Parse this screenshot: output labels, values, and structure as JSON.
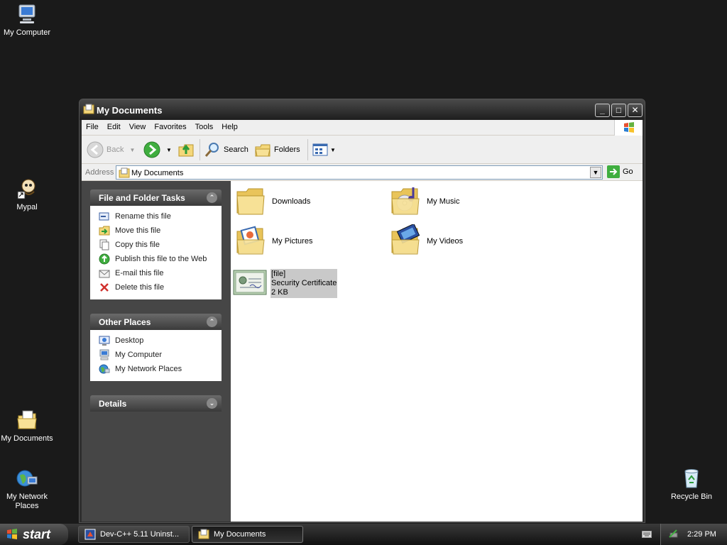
{
  "desktop": {
    "icons": [
      {
        "label": "My Computer"
      },
      {
        "label": "Mypal"
      },
      {
        "label": "My Documents"
      },
      {
        "label": "My Network Places"
      },
      {
        "label": "Recycle Bin"
      }
    ]
  },
  "window": {
    "title": "My Documents",
    "menu": [
      "File",
      "Edit",
      "View",
      "Favorites",
      "Tools",
      "Help"
    ],
    "toolbar": {
      "back_label": "Back",
      "search_label": "Search",
      "folders_label": "Folders"
    },
    "address": {
      "label": "Address",
      "value": "My Documents",
      "go_label": "Go"
    },
    "taskpane": {
      "file_tasks": {
        "title": "File and Folder Tasks",
        "items": [
          {
            "label": "Rename this file",
            "icon": "rename-icon"
          },
          {
            "label": "Move this file",
            "icon": "move-icon"
          },
          {
            "label": "Copy this file",
            "icon": "copy-icon"
          },
          {
            "label": "Publish this file to the Web",
            "icon": "publish-icon"
          },
          {
            "label": "E-mail this file",
            "icon": "email-icon"
          },
          {
            "label": "Delete this file",
            "icon": "delete-icon"
          }
        ]
      },
      "other_places": {
        "title": "Other Places",
        "items": [
          {
            "label": "Desktop",
            "icon": "desktop-icon"
          },
          {
            "label": "My Computer",
            "icon": "computer-icon"
          },
          {
            "label": "My Network Places",
            "icon": "network-icon"
          }
        ]
      },
      "details": {
        "title": "Details"
      }
    },
    "files": [
      {
        "name": "Downloads",
        "type": "folder"
      },
      {
        "name": "My Music",
        "type": "music-folder"
      },
      {
        "name": "My Pictures",
        "type": "pictures-folder"
      },
      {
        "name": "My Videos",
        "type": "videos-folder"
      },
      {
        "name": "[file]",
        "kind": "Security Certificate",
        "size": "2 KB",
        "type": "certificate",
        "selected": true
      }
    ]
  },
  "taskbar": {
    "start_label": "start",
    "tasks": [
      {
        "label": "Dev-C++ 5.11 Uninst..."
      },
      {
        "label": "My Documents",
        "active": true
      }
    ],
    "clock": "2:29 PM"
  },
  "colors": {
    "desktop_bg": "#1a1a1a",
    "window_frame": "#2e2e2e",
    "content_bg": "#ffffff",
    "selection": "#c9c9c9"
  }
}
